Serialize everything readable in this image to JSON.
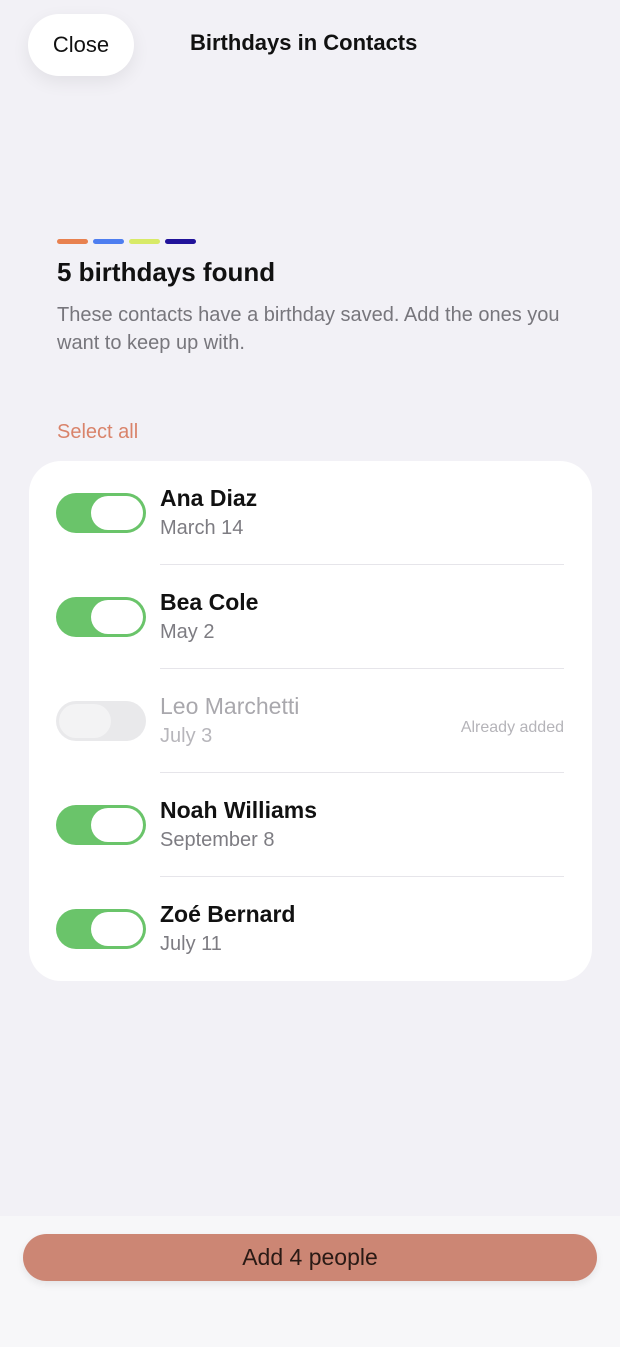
{
  "header": {
    "close_label": "Close",
    "title": "Birthdays in Contacts"
  },
  "accent_colors": [
    "#e8814f",
    "#4e7ef0",
    "#d8ea67",
    "#21139a"
  ],
  "intro": {
    "heading": "5 birthdays found",
    "description": "These contacts have a birthday saved. Add the ones you want to keep up with."
  },
  "select_all_label": "Select all",
  "contacts": [
    {
      "name": "Ana Diaz",
      "date": "March 14",
      "selected": true,
      "note": ""
    },
    {
      "name": "Bea Cole",
      "date": "May 2",
      "selected": true,
      "note": ""
    },
    {
      "name": "Leo Marchetti",
      "date": "July 3",
      "selected": false,
      "note": "Already added"
    },
    {
      "name": "Noah Williams",
      "date": "September 8",
      "selected": true,
      "note": ""
    },
    {
      "name": "Zoé Bernard",
      "date": "July 11",
      "selected": true,
      "note": ""
    }
  ],
  "footer": {
    "add_button_label": "Add 4 people"
  }
}
